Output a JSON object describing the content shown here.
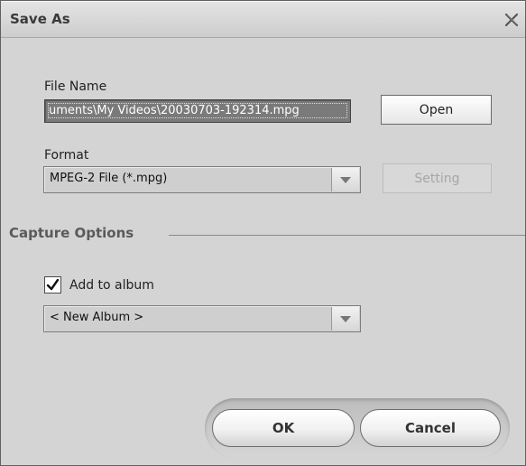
{
  "window": {
    "title": "Save As",
    "close_icon": "close-x-icon"
  },
  "file_name": {
    "label": "File Name",
    "value": "uments\\My Videos\\20030703-192314.mpg",
    "open_button": "Open"
  },
  "format": {
    "label": "Format",
    "selected": "MPEG-2 File (*.mpg)",
    "setting_button": "Setting",
    "setting_enabled": false
  },
  "capture_options": {
    "title": "Capture Options",
    "add_to_album": {
      "label": "Add to album",
      "checked": true
    },
    "album_selected": "< New Album >"
  },
  "footer": {
    "ok_label": "OK",
    "cancel_label": "Cancel"
  }
}
